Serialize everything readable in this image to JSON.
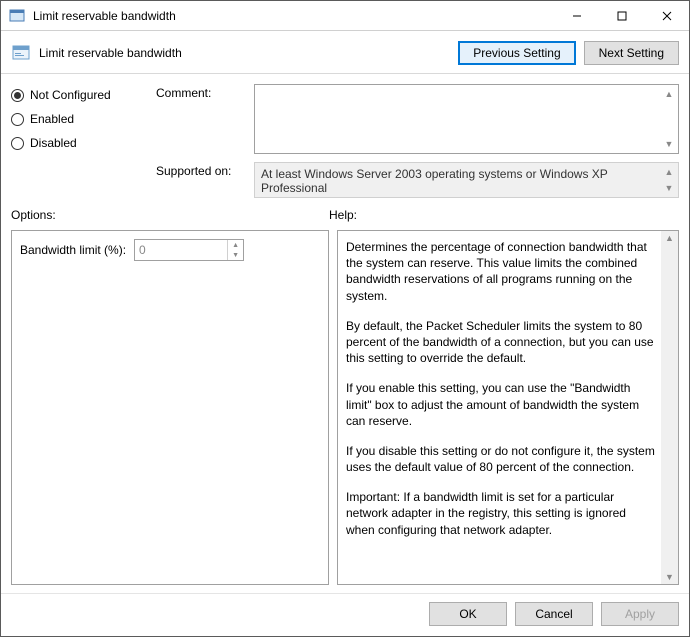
{
  "window": {
    "title": "Limit reservable bandwidth"
  },
  "subheader": {
    "title": "Limit reservable bandwidth",
    "prev": "Previous Setting",
    "next": "Next Setting"
  },
  "state": {
    "not_configured": "Not Configured",
    "enabled": "Enabled",
    "disabled": "Disabled",
    "selected": "not_configured"
  },
  "fields": {
    "comment_label": "Comment:",
    "comment_value": "",
    "supported_label": "Supported on:",
    "supported_value": "At least Windows Server 2003 operating systems or Windows XP Professional"
  },
  "sections": {
    "options": "Options:",
    "help": "Help:"
  },
  "options": {
    "bandwidth_label": "Bandwidth limit (%):",
    "bandwidth_value": "0"
  },
  "help": {
    "p1": "Determines the percentage of connection bandwidth that the system can reserve. This value limits the combined bandwidth reservations of all programs running on the system.",
    "p2": "By default, the Packet Scheduler limits the system to 80 percent of the bandwidth of a connection, but you can use this setting to override the default.",
    "p3": "If you enable this setting, you can use the \"Bandwidth limit\" box to adjust the amount of bandwidth the system can reserve.",
    "p4": "If you disable this setting or do not configure it, the system uses the default value of 80 percent of the connection.",
    "p5": "Important: If a bandwidth limit is set for a particular network adapter in the registry, this setting is ignored when configuring that network adapter."
  },
  "footer": {
    "ok": "OK",
    "cancel": "Cancel",
    "apply": "Apply"
  }
}
